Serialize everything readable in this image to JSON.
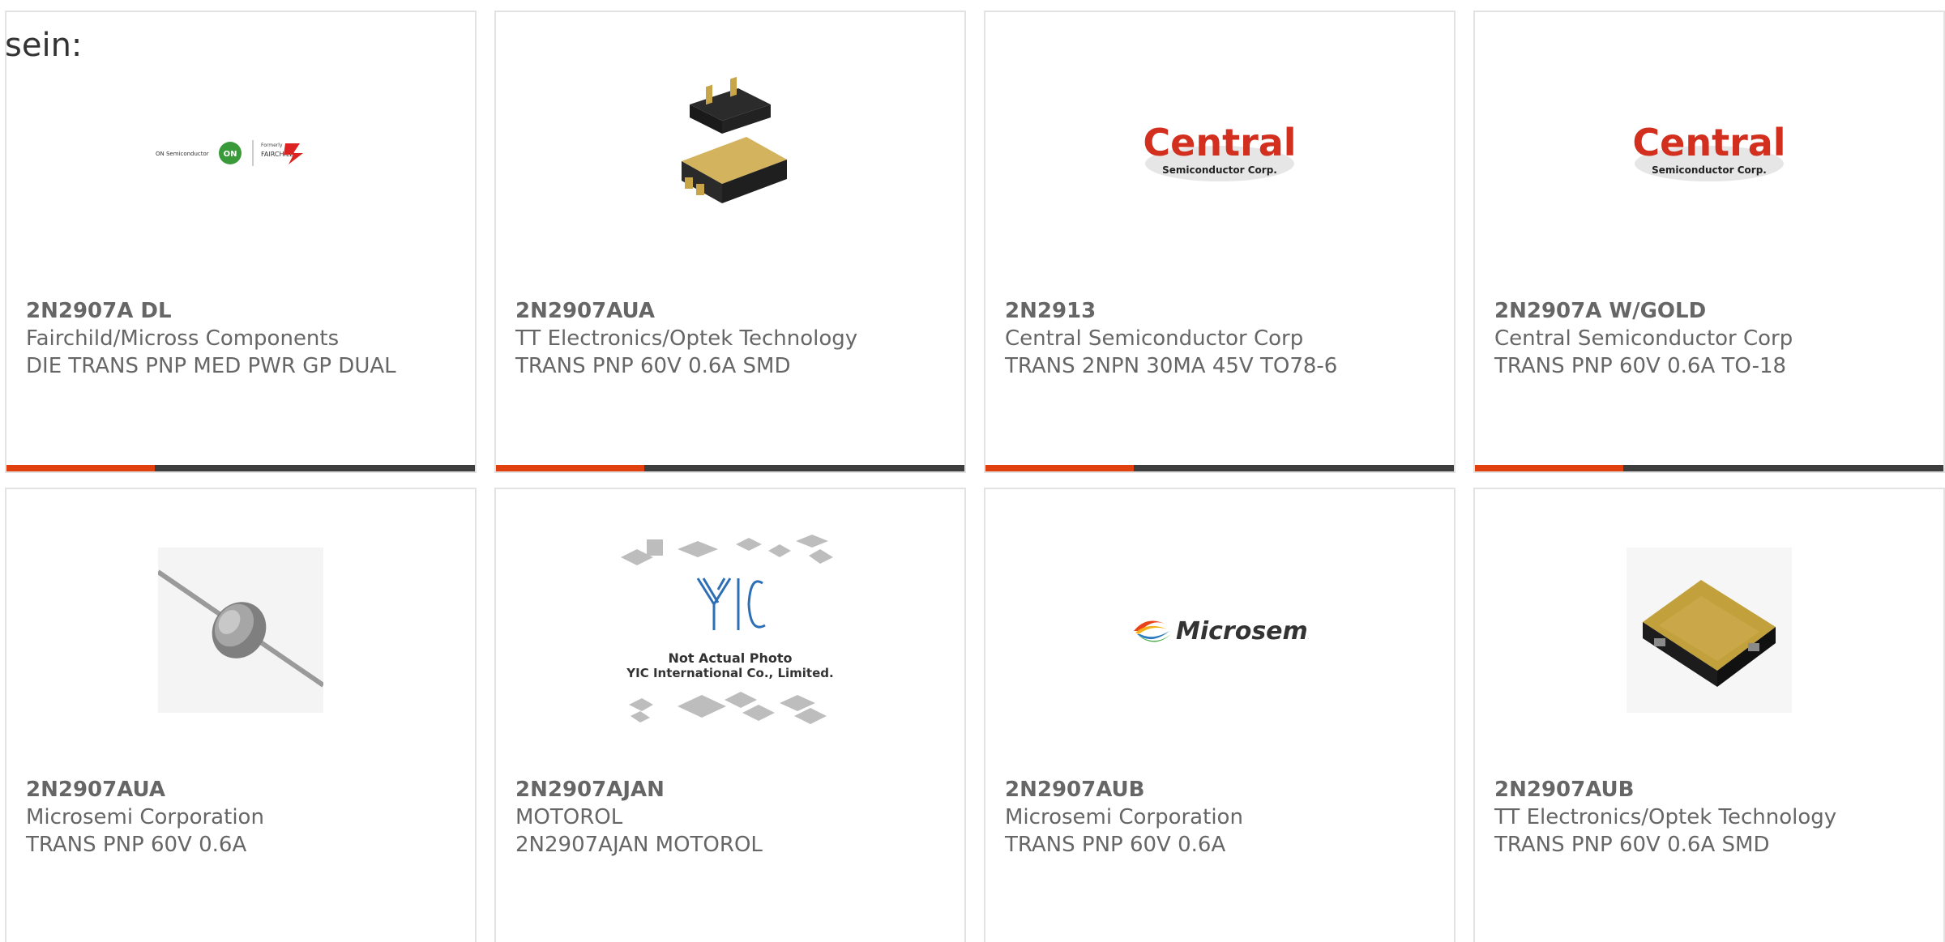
{
  "heading": "sein:",
  "colors": {
    "accent": "#e0400d",
    "bar": "#3d3d3d",
    "border": "#e2e2e2",
    "text": "#666666"
  },
  "cards": [
    {
      "part_number": "2N2907A DL",
      "manufacturer": "Fairchild/Micross Components",
      "description": "DIE TRANS PNP MED PWR GP DUAL",
      "image": "onsemi-fairchild-logo",
      "logo_text_left": "ON Semiconductor",
      "logo_badge": "ON",
      "logo_text_right": "FAIRCHILD",
      "logo_formerly": "Formerly"
    },
    {
      "part_number": "2N2907AUA",
      "manufacturer": "TT Electronics/Optek Technology",
      "description": "TRANS PNP 60V 0.6A SMD",
      "image": "smd-package-photo"
    },
    {
      "part_number": "2N2913",
      "manufacturer": "Central Semiconductor Corp",
      "description": "TRANS 2NPN 30MA 45V TO78-6",
      "image": "central-semiconductor-logo",
      "logo_main": "Central",
      "logo_sub": "Semiconductor Corp."
    },
    {
      "part_number": "2N2907A W/GOLD",
      "manufacturer": "Central Semiconductor Corp",
      "description": "TRANS PNP 60V 0.6A TO-18",
      "image": "central-semiconductor-logo",
      "logo_main": "Central",
      "logo_sub": "Semiconductor Corp."
    },
    {
      "part_number": "2N2907AUA",
      "manufacturer": "Microsemi Corporation",
      "description": "TRANS PNP 60V 0.6A",
      "image": "axial-diode-photo"
    },
    {
      "part_number": "2N2907AJAN",
      "manufacturer": "MOTOROL",
      "description": "2N2907AJAN MOTOROL",
      "image": "yic-placeholder",
      "logo_main": "YIC",
      "logo_line1": "Not Actual Photo",
      "logo_line2": "YIC International Co., Limited."
    },
    {
      "part_number": "2N2907AUB",
      "manufacturer": "Microsemi Corporation",
      "description": "TRANS PNP 60V 0.6A",
      "image": "microsemi-logo",
      "logo_main": "Microsemi"
    },
    {
      "part_number": "2N2907AUB",
      "manufacturer": "TT Electronics/Optek Technology",
      "description": "TRANS PNP 60V 0.6A SMD",
      "image": "gold-smd-chip-photo"
    }
  ]
}
